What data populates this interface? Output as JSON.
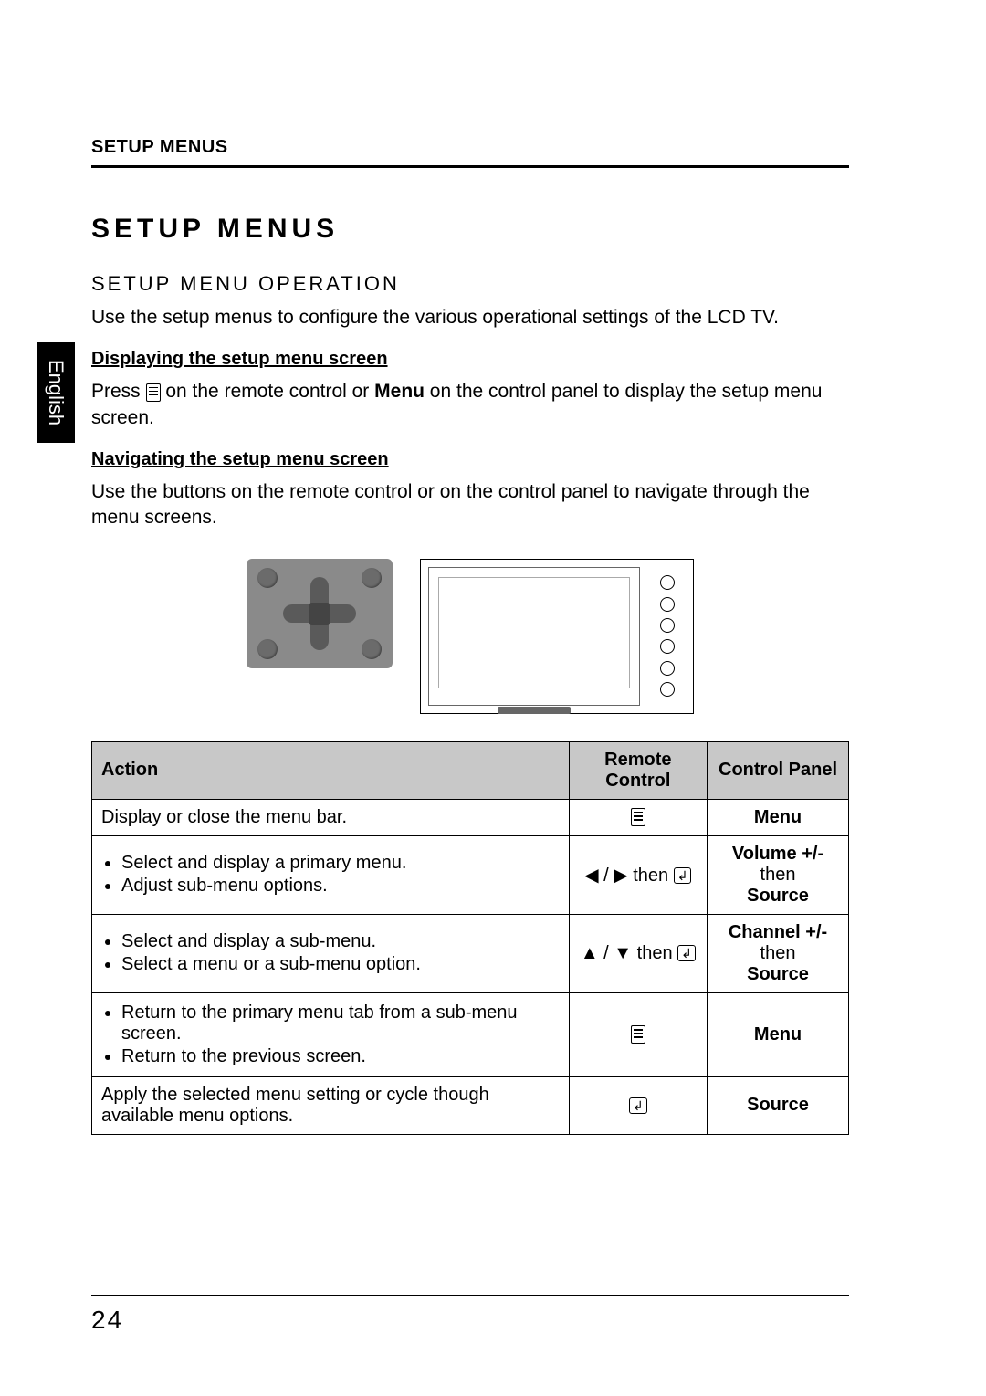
{
  "header": "SETUP MENUS",
  "language_tab": "English",
  "title": "SETUP MENUS",
  "section": "SETUP MENU OPERATION",
  "intro": "Use the setup menus to configure the various operational settings of the LCD TV.",
  "sub1_heading": "Displaying the setup menu screen",
  "sub1_p_pre": "Press ",
  "sub1_p_mid": " on the remote control or ",
  "sub1_p_bold": "Menu",
  "sub1_p_post": " on the control panel to display the setup menu screen.",
  "sub2_heading": "Navigating the setup menu screen",
  "sub2_p": "Use the buttons on the remote control or on the control panel to navigate through the menu screens.",
  "table": {
    "headers": [
      "Action",
      "Remote Control",
      "Control Panel"
    ],
    "rows": [
      {
        "action_plain": "Display or close the menu bar.",
        "remote": "menu-icon",
        "panel_bold": "Menu"
      },
      {
        "action_list": [
          "Select and display a primary menu.",
          "Adjust sub-menu options."
        ],
        "remote_seq": {
          "a": "◀",
          "sep": " / ",
          "b": "▶",
          "then": " then ",
          "enter": true
        },
        "panel_bold": "Volume +/-",
        "panel_then": " then ",
        "panel_bold2": "Source"
      },
      {
        "action_list": [
          "Select and display a sub-menu.",
          "Select a menu or a sub-menu option."
        ],
        "remote_seq": {
          "a": "▲",
          "sep": " / ",
          "b": "▼",
          "then": " then ",
          "enter": true
        },
        "panel_bold": "Channel +/-",
        "panel_then": " then ",
        "panel_bold2": "Source"
      },
      {
        "action_list": [
          "Return to the primary menu tab from a sub-menu screen.",
          "Return to the previous screen."
        ],
        "remote": "menu-icon",
        "panel_bold": "Menu"
      },
      {
        "action_plain": "Apply the selected menu setting or cycle though available menu options.",
        "remote": "enter-icon",
        "panel_bold": "Source"
      }
    ]
  },
  "page_number": "24"
}
